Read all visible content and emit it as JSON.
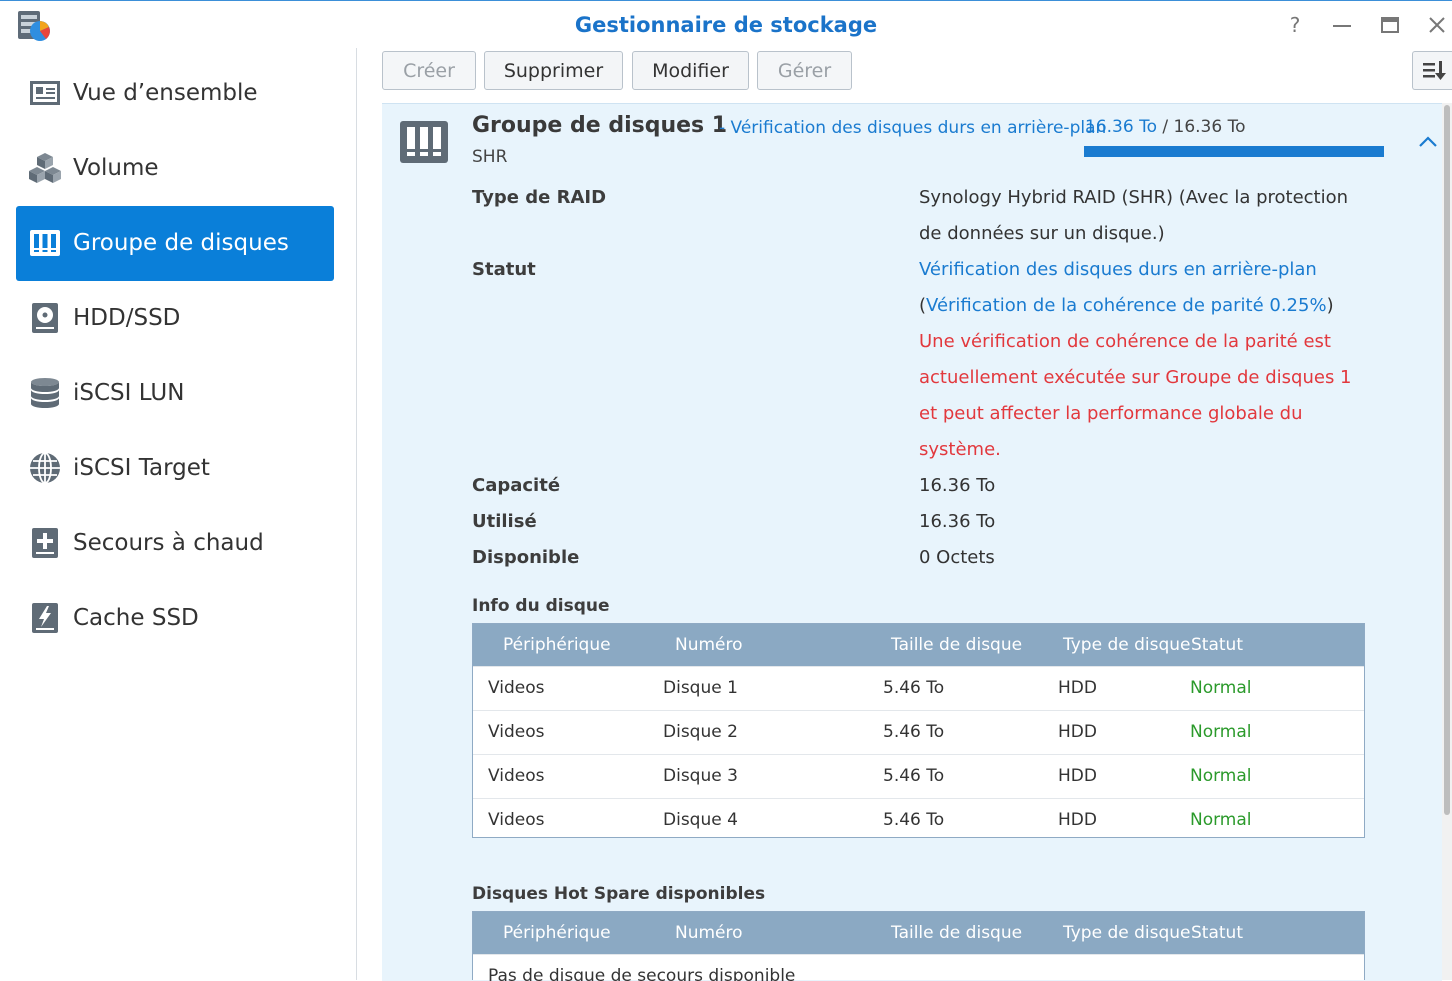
{
  "window": {
    "title": "Gestionnaire de stockage"
  },
  "sidebar": {
    "items": [
      {
        "label": "Vue d’ensemble",
        "icon": "overview-icon"
      },
      {
        "label": "Volume",
        "icon": "volume-cubes-icon"
      },
      {
        "label": "Groupe de disques",
        "icon": "disk-group-icon",
        "active": true
      },
      {
        "label": "HDD/SSD",
        "icon": "hdd-icon"
      },
      {
        "label": "iSCSI LUN",
        "icon": "database-icon"
      },
      {
        "label": "iSCSI Target",
        "icon": "globe-icon"
      },
      {
        "label": "Secours à chaud",
        "icon": "hot-spare-plus-icon"
      },
      {
        "label": "Cache SSD",
        "icon": "ssd-cache-bolt-icon"
      }
    ]
  },
  "toolbar": {
    "create": "Créer",
    "delete": "Supprimer",
    "edit": "Modifier",
    "manage": "Gérer"
  },
  "group": {
    "title": "Groupe de disques 1",
    "status_prefix": "- Vérification des disques durs en arrière-plan",
    "subtype": "SHR",
    "capacity_used": "16.36 To",
    "capacity_sep": " / ",
    "capacity_total": "16.36 To",
    "usage_fraction": 1.0
  },
  "details": {
    "raid_label": "Type de RAID",
    "raid_value_1": "Synology Hybrid RAID (SHR) (Avec la protection",
    "raid_value_2": "de données sur un disque.)",
    "status_label": "Statut",
    "status_line1": "Vérification des disques durs en arrière-plan",
    "status_line2_open": "(",
    "status_line2_link": "Vérification de la cohérence de parité 0.25%",
    "status_line2_close": ")",
    "warning_1": "Une vérification de cohérence de la parité est",
    "warning_2": "actuellement exécutée sur Groupe de disques 1",
    "warning_3": "et peut affecter la performance globale du",
    "warning_4": "système.",
    "capacity_label": "Capacité",
    "capacity_value": "16.36 To",
    "used_label": "Utilisé",
    "used_value": "16.36 To",
    "available_label": "Disponible",
    "available_value": "0 Octets"
  },
  "disk_info": {
    "title": "Info du disque",
    "columns": [
      "Périphérique",
      "Numéro",
      "Taille de disque",
      "Type de disque",
      "Statut"
    ],
    "rows": [
      [
        "Videos",
        "Disque 1",
        "5.46 To",
        "HDD",
        "Normal"
      ],
      [
        "Videos",
        "Disque 2",
        "5.46 To",
        "HDD",
        "Normal"
      ],
      [
        "Videos",
        "Disque 3",
        "5.46 To",
        "HDD",
        "Normal"
      ],
      [
        "Videos",
        "Disque 4",
        "5.46 To",
        "HDD",
        "Normal"
      ]
    ]
  },
  "hot_spare": {
    "title": "Disques Hot Spare disponibles",
    "columns": [
      "Périphérique",
      "Numéro",
      "Taille de disque",
      "Type de disque",
      "Statut"
    ],
    "empty": "Pas de disque de secours disponible"
  },
  "colors": {
    "accent": "#0a7fd9",
    "link": "#1a7bd0",
    "warning": "#e2383d",
    "ok": "#2b9a2b",
    "table_header": "#8ba9c3",
    "panel": "#e8f4fc"
  }
}
